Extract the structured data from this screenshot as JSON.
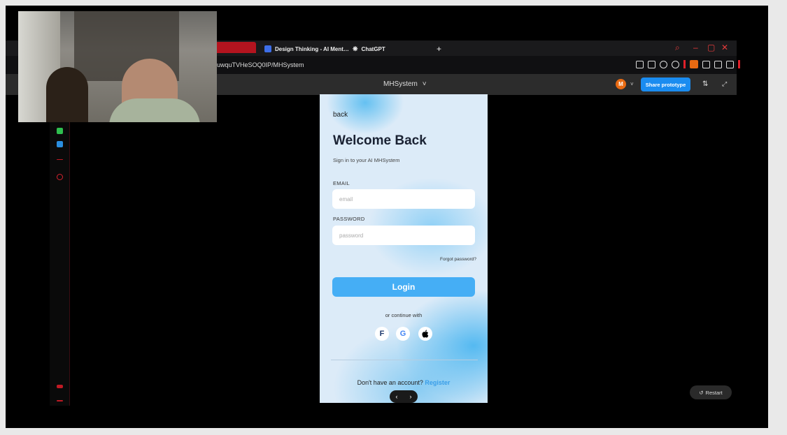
{
  "browser": {
    "tabs": [
      {
        "label": "Design Thinking - AI Ment…"
      },
      {
        "label": "ChatGPT"
      }
    ],
    "new_tab": "+",
    "url": "uwquTVHeSOQ0IP/MHSystem",
    "window_controls": {
      "search": "⌕",
      "minimize": "–",
      "restore": "▢",
      "close": "✕"
    }
  },
  "figma": {
    "file_title": "MHSystem",
    "title_chevron": "˅",
    "avatar_initial": "M",
    "avatar_chevron": "˅",
    "share_label": "Share prototype",
    "settings_icon": "⇅",
    "expand_icon": "⤢",
    "restart_label": "Restart"
  },
  "app": {
    "back_label": "back",
    "title": "Welcome Back",
    "subtitle": "Sign in to your AI MHSystem",
    "email": {
      "label": "EMAIL",
      "placeholder": "email"
    },
    "password": {
      "label": "PASSWORD",
      "placeholder": "password"
    },
    "forgot_label": "Forgot password?",
    "login_label": "Login",
    "continue_label": "or continue with",
    "social": [
      {
        "name": "facebook",
        "glyph": "F",
        "color": "#1e3a6e"
      },
      {
        "name": "google",
        "glyph": "G",
        "color": "#4285f4"
      },
      {
        "name": "apple",
        "glyph": "",
        "color": "#000000"
      }
    ],
    "no_account_text": "Don't have an account?",
    "register_label": "Register",
    "pager_prev": "‹",
    "pager_next": "›"
  },
  "colors": {
    "accent_login": "#45aef5",
    "share_button": "#1a8cf0",
    "browser_accent": "#b4141f",
    "avatar": "#e86a12"
  }
}
